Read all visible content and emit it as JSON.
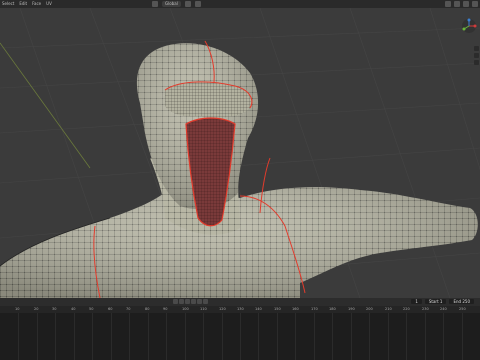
{
  "header": {
    "menus": [
      "Select",
      "Edit",
      "Face",
      "UV"
    ],
    "pivot_label": "Global",
    "options_label": "Options"
  },
  "timeline": {
    "current_frame": "1",
    "start_frame": "1",
    "start_label": "Start",
    "end_frame": "250",
    "end_label": "End",
    "ruler_ticks": [
      "10",
      "20",
      "30",
      "40",
      "50",
      "60",
      "70",
      "80",
      "90",
      "100",
      "110",
      "120",
      "130",
      "140",
      "150",
      "160",
      "170",
      "180",
      "190",
      "200",
      "210",
      "220",
      "230",
      "240",
      "250"
    ]
  },
  "colors": {
    "mesh_base": "#b9b8a6",
    "wire": "#1a1a1a",
    "seam": "#e23b2c",
    "mouth_inner": "#7b3a3a",
    "grid_bg": "#3b3b3b"
  },
  "icons": [
    "nav-gizmo-icon",
    "zoom-icon",
    "hand-icon",
    "camera-icon",
    "play-icon",
    "stop-icon",
    "jump-start-icon",
    "jump-end-icon"
  ]
}
